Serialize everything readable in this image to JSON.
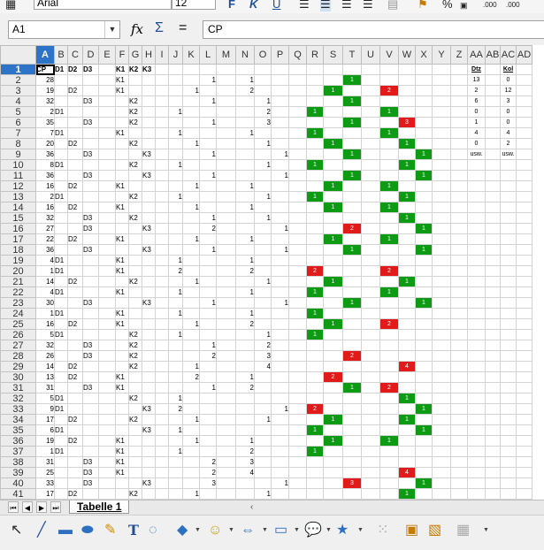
{
  "toolbar": {
    "font_name": "Arial",
    "font_size": "12",
    "bold_label": "F",
    "italic_label": "K",
    "underline_label": "U",
    "decimal_add_label": ".000",
    "decimal_remove_label": ".000"
  },
  "formula_bar": {
    "cell_ref": "A1",
    "formula": "CP"
  },
  "sheet": {
    "columns": [
      "A",
      "B",
      "C",
      "D",
      "E",
      "F",
      "G",
      "H",
      "I",
      "J",
      "K",
      "L",
      "M",
      "N",
      "O",
      "P",
      "Q",
      "R",
      "S",
      "T",
      "U",
      "V",
      "W",
      "X",
      "Y",
      "Z",
      "AA",
      "AB",
      "AC",
      "AD"
    ],
    "selected_column": "A",
    "selected_row": 1,
    "rows": [
      {
        "n": "1",
        "cells": {
          "A": "CP",
          "B": "D1",
          "C": "D2",
          "D": "D3",
          "F": "K1",
          "G": "K2",
          "H": "K3"
        }
      },
      {
        "n": "2",
        "cells": {
          "A": "28",
          "F": "K1",
          "L": "1",
          "N": "1",
          "T": "1"
        },
        "fill": {
          "T": "g"
        },
        "aa": "13",
        "ac": "0"
      },
      {
        "n": "3",
        "cells": {
          "A": "19",
          "C": "D2",
          "F": "K1",
          "K": "1",
          "N": "2",
          "S": "1",
          "V": "2"
        },
        "fill": {
          "S": "g",
          "V": "r"
        },
        "aa": "2",
        "ac": "12"
      },
      {
        "n": "4",
        "cells": {
          "A": "32",
          "D": "D3",
          "G": "K2",
          "L": "1",
          "O": "1",
          "T": "1"
        },
        "fill": {
          "T": "g"
        },
        "aa": "6",
        "ac": "3"
      },
      {
        "n": "5",
        "cells": {
          "A": "2",
          "B": "D1",
          "G": "K2",
          "J": "1",
          "O": "2",
          "R": "1",
          "V": "1"
        },
        "fill": {
          "R": "g",
          "V": "g"
        },
        "aa": "0",
        "ac": "0"
      },
      {
        "n": "6",
        "cells": {
          "A": "35",
          "D": "D3",
          "G": "K2",
          "L": "1",
          "O": "3",
          "T": "1",
          "W": "3"
        },
        "fill": {
          "T": "g",
          "W": "r"
        },
        "aa": "1",
        "ac": "0"
      },
      {
        "n": "7",
        "cells": {
          "A": "7",
          "B": "D1",
          "F": "K1",
          "J": "1",
          "N": "1",
          "R": "1",
          "V": "1"
        },
        "fill": {
          "R": "g",
          "V": "g"
        },
        "aa": "4",
        "ac": "4"
      },
      {
        "n": "8",
        "cells": {
          "A": "20",
          "C": "D2",
          "G": "K2",
          "K": "1",
          "O": "1",
          "S": "1",
          "W": "1"
        },
        "fill": {
          "S": "g",
          "W": "g"
        },
        "aa": "0",
        "ac": "2"
      },
      {
        "n": "9",
        "cells": {
          "A": "36",
          "D": "D3",
          "H": "K3",
          "L": "1",
          "P": "1",
          "T": "1",
          "X": "1"
        },
        "fill": {
          "T": "g",
          "X": "g"
        },
        "aa": "usw.",
        "ac": "usw."
      },
      {
        "n": "10",
        "cells": {
          "A": "8",
          "B": "D1",
          "G": "K2",
          "J": "1",
          "O": "1",
          "R": "1",
          "W": "1"
        },
        "fill": {
          "R": "g",
          "W": "g"
        }
      },
      {
        "n": "11",
        "cells": {
          "A": "36",
          "D": "D3",
          "H": "K3",
          "L": "1",
          "P": "1",
          "T": "1",
          "X": "1"
        },
        "fill": {
          "T": "g",
          "X": "g"
        }
      },
      {
        "n": "12",
        "cells": {
          "A": "16",
          "C": "D2",
          "F": "K1",
          "K": "1",
          "N": "1",
          "S": "1",
          "V": "1"
        },
        "fill": {
          "S": "g",
          "V": "g"
        }
      },
      {
        "n": "13",
        "cells": {
          "A": "2",
          "B": "D1",
          "G": "K2",
          "J": "1",
          "O": "1",
          "R": "1",
          "W": "1"
        },
        "fill": {
          "R": "g",
          "W": "g"
        }
      },
      {
        "n": "14",
        "cells": {
          "A": "16",
          "C": "D2",
          "F": "K1",
          "K": "1",
          "N": "1",
          "S": "1",
          "V": "1"
        },
        "fill": {
          "S": "g",
          "V": "g"
        }
      },
      {
        "n": "15",
        "cells": {
          "A": "32",
          "D": "D3",
          "G": "K2",
          "L": "1",
          "O": "1",
          "W": "1"
        },
        "fill": {
          "W": "g"
        }
      },
      {
        "n": "16",
        "cells": {
          "A": "27",
          "D": "D3",
          "H": "K3",
          "L": "2",
          "P": "1",
          "T": "2",
          "X": "1"
        },
        "fill": {
          "T": "r",
          "X": "g"
        }
      },
      {
        "n": "17",
        "cells": {
          "A": "22",
          "C": "D2",
          "F": "K1",
          "K": "1",
          "N": "1",
          "S": "1",
          "V": "1"
        },
        "fill": {
          "S": "g",
          "V": "g"
        }
      },
      {
        "n": "18",
        "cells": {
          "A": "36",
          "D": "D3",
          "H": "K3",
          "L": "1",
          "P": "1",
          "T": "1",
          "X": "1"
        },
        "fill": {
          "T": "g",
          "X": "g"
        }
      },
      {
        "n": "19",
        "cells": {
          "A": "4",
          "B": "D1",
          "F": "K1",
          "J": "1",
          "N": "1"
        }
      },
      {
        "n": "20",
        "cells": {
          "A": "1",
          "B": "D1",
          "F": "K1",
          "J": "2",
          "N": "2",
          "R": "2",
          "V": "2"
        },
        "fill": {
          "R": "r",
          "V": "r"
        }
      },
      {
        "n": "21",
        "cells": {
          "A": "14",
          "C": "D2",
          "G": "K2",
          "K": "1",
          "O": "1",
          "S": "1",
          "W": "1"
        },
        "fill": {
          "S": "g",
          "W": "g"
        }
      },
      {
        "n": "22",
        "cells": {
          "A": "4",
          "B": "D1",
          "F": "K1",
          "J": "1",
          "N": "1",
          "R": "1",
          "V": "1"
        },
        "fill": {
          "R": "g",
          "V": "g"
        }
      },
      {
        "n": "23",
        "cells": {
          "A": "30",
          "D": "D3",
          "H": "K3",
          "L": "1",
          "P": "1",
          "T": "1",
          "X": "1"
        },
        "fill": {
          "T": "g",
          "X": "g"
        }
      },
      {
        "n": "24",
        "cells": {
          "A": "1",
          "B": "D1",
          "F": "K1",
          "J": "1",
          "N": "1",
          "R": "1"
        },
        "fill": {
          "R": "g"
        }
      },
      {
        "n": "25",
        "cells": {
          "A": "16",
          "C": "D2",
          "F": "K1",
          "K": "1",
          "N": "2",
          "S": "1",
          "V": "2"
        },
        "fill": {
          "S": "g",
          "V": "r"
        }
      },
      {
        "n": "26",
        "cells": {
          "A": "5",
          "B": "D1",
          "G": "K2",
          "J": "1",
          "O": "1",
          "R": "1"
        },
        "fill": {
          "R": "g"
        }
      },
      {
        "n": "27",
        "cells": {
          "A": "32",
          "D": "D3",
          "G": "K2",
          "L": "1",
          "O": "2"
        }
      },
      {
        "n": "28",
        "cells": {
          "A": "26",
          "D": "D3",
          "G": "K2",
          "L": "2",
          "O": "3",
          "T": "2"
        },
        "fill": {
          "T": "r"
        }
      },
      {
        "n": "29",
        "cells": {
          "A": "14",
          "C": "D2",
          "G": "K2",
          "K": "1",
          "O": "4",
          "W": "4"
        },
        "fill": {
          "W": "r"
        }
      },
      {
        "n": "30",
        "cells": {
          "A": "13",
          "C": "D2",
          "F": "K1",
          "K": "2",
          "N": "1",
          "S": "2"
        },
        "fill": {
          "S": "r"
        }
      },
      {
        "n": "31",
        "cells": {
          "A": "31",
          "D": "D3",
          "F": "K1",
          "L": "1",
          "N": "2",
          "T": "1",
          "V": "2"
        },
        "fill": {
          "T": "g",
          "V": "r"
        }
      },
      {
        "n": "32",
        "cells": {
          "A": "5",
          "B": "D1",
          "G": "K2",
          "J": "1",
          "W": "1"
        },
        "fill": {
          "W": "g"
        }
      },
      {
        "n": "33",
        "cells": {
          "A": "9",
          "B": "D1",
          "H": "K3",
          "J": "2",
          "P": "1",
          "R": "2",
          "X": "1"
        },
        "fill": {
          "R": "r",
          "X": "g"
        }
      },
      {
        "n": "34",
        "cells": {
          "A": "17",
          "C": "D2",
          "G": "K2",
          "K": "1",
          "O": "1",
          "S": "1",
          "W": "1"
        },
        "fill": {
          "S": "g",
          "W": "g"
        }
      },
      {
        "n": "35",
        "cells": {
          "A": "6",
          "B": "D1",
          "H": "K3",
          "J": "1",
          "R": "1",
          "X": "1"
        },
        "fill": {
          "R": "g",
          "X": "g"
        }
      },
      {
        "n": "36",
        "cells": {
          "A": "19",
          "C": "D2",
          "F": "K1",
          "K": "1",
          "N": "1",
          "S": "1",
          "V": "1"
        },
        "fill": {
          "S": "g",
          "V": "g"
        }
      },
      {
        "n": "37",
        "cells": {
          "A": "1",
          "B": "D1",
          "F": "K1",
          "J": "1",
          "N": "2",
          "R": "1"
        },
        "fill": {
          "R": "g"
        }
      },
      {
        "n": "38",
        "cells": {
          "A": "31",
          "D": "D3",
          "F": "K1",
          "L": "2",
          "N": "3"
        }
      },
      {
        "n": "39",
        "cells": {
          "A": "25",
          "D": "D3",
          "F": "K1",
          "L": "2",
          "N": "4",
          "W": "4"
        },
        "fill": {
          "W": "r"
        }
      },
      {
        "n": "40",
        "cells": {
          "A": "33",
          "D": "D3",
          "H": "K3",
          "L": "3",
          "P": "1",
          "T": "3",
          "X": "1"
        },
        "fill": {
          "T": "r",
          "X": "g"
        }
      },
      {
        "n": "41",
        "cells": {
          "A": "17",
          "C": "D2",
          "G": "K2",
          "K": "1",
          "O": "1",
          "W": "1"
        },
        "fill": {
          "W": "g"
        }
      },
      {
        "n": "42",
        "cells": {
          "A": "22",
          "C": "D2",
          "F": "K1",
          "K": "2",
          "N": "1",
          "S": "2"
        },
        "fill": {
          "S": "r"
        }
      },
      {
        "n": "43",
        "cells": {
          "A": "7",
          "B": "D1",
          "F": "K1",
          "J": "1",
          "N": "2",
          "R": "1",
          "V": "2"
        },
        "fill": {
          "R": "g",
          "V": "r"
        }
      },
      {
        "n": "44",
        "cells": {
          "A": "17",
          "C": "D2",
          "G": "K2",
          "K": "1",
          "O": "1",
          "W": "1"
        },
        "fill": {
          "W": "g"
        }
      },
      {
        "n": "45",
        "cells": {
          "A": "9",
          "B": "D1",
          "H": "K3",
          "J": "1",
          "P": "1",
          "X": "1"
        },
        "fill": {
          "X": "g"
        }
      }
    ],
    "aa_header": "Dtz",
    "ac_header": "Kol"
  },
  "tabs": {
    "sheet_name": "Tabelle 1"
  },
  "colors": {
    "green": "#0d9b13",
    "red": "#e21a1a",
    "selection": "#2d74c9"
  },
  "draw_toolbar": {
    "icons": [
      "select-arrow-icon",
      "line-icon",
      "rectangle-icon",
      "ellipse-icon",
      "freeform-icon",
      "text-icon",
      "callout-icon",
      "basic-shapes-icon",
      "smiley-icon",
      "arrows-icon",
      "flowchart-icon",
      "callouts-icon",
      "stars-icon",
      "points-icon",
      "fontwork-icon",
      "image-icon",
      "shadow-icon"
    ]
  }
}
